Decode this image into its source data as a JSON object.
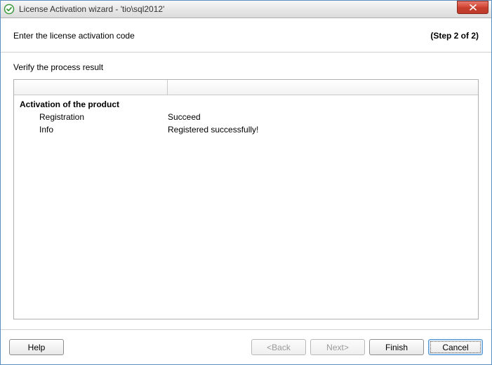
{
  "window": {
    "title": "License Activation wizard - 'tio\\sql2012'"
  },
  "header": {
    "instruction": "Enter the license activation code",
    "step": "(Step 2 of 2)"
  },
  "content": {
    "verify_label": "Verify the process result",
    "section_title": "Activation of the product",
    "rows": [
      {
        "key": "Registration",
        "value": "Succeed"
      },
      {
        "key": "Info",
        "value": "Registered successfully!"
      }
    ]
  },
  "footer": {
    "help": "Help",
    "back": "<Back",
    "next": "Next>",
    "finish": "Finish",
    "cancel": "Cancel"
  }
}
